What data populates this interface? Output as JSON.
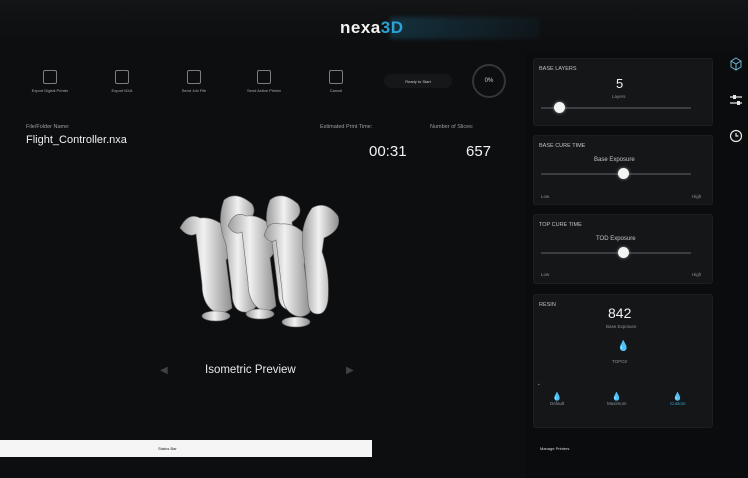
{
  "app": {
    "brand": "nexa",
    "brand_suffix": "3D",
    "accent": "#2aa2d4"
  },
  "toolbar": {
    "items": [
      {
        "label": "Export Digital Printer",
        "icon": "export-icon"
      },
      {
        "label": "Export NXA",
        "icon": "download-icon"
      },
      {
        "label": "Send Job File",
        "icon": "send-icon"
      },
      {
        "label": "Send Active Printer",
        "icon": "printer-icon"
      },
      {
        "label": "Cancel",
        "icon": "cancel-icon"
      }
    ],
    "pill_label": "Ready to Start",
    "progress_percent": "0%"
  },
  "file": {
    "caption": "File/Folder Name:",
    "name": "Flight_Controller.nxa"
  },
  "stats": {
    "print_time_label": "Estimated Print Time:",
    "print_time_value": "00:31",
    "slices_label": "Number of Slices:",
    "slices_value": "657"
  },
  "preview": {
    "label": "Isometric Preview"
  },
  "status_bar": {
    "left_top": "",
    "left_bottom": "",
    "middle": "Status Bar",
    "right": "Manage Printers"
  },
  "panels": {
    "base_layers": {
      "title": "BASE LAYERS",
      "value": "5",
      "unit": "Layers",
      "level": 0.12
    },
    "base_cure": {
      "title": "BASE CURE TIME",
      "sub": "Base Exposure",
      "low": "Low",
      "high": "High",
      "level": 0.55
    },
    "top_cure": {
      "title": "TOP CURE TIME",
      "sub": "TOD Exposure",
      "low": "Low",
      "high": "High",
      "level": 0.55
    },
    "resin": {
      "title": "RESIN",
      "value": "842",
      "value_sub": "Base Exposure",
      "drop_caption": "TOPO2",
      "buttons": [
        "Default",
        "Maximum",
        "Custom"
      ]
    }
  },
  "side_icons": [
    "cube-icon",
    "sliders-icon",
    "clock-icon"
  ]
}
